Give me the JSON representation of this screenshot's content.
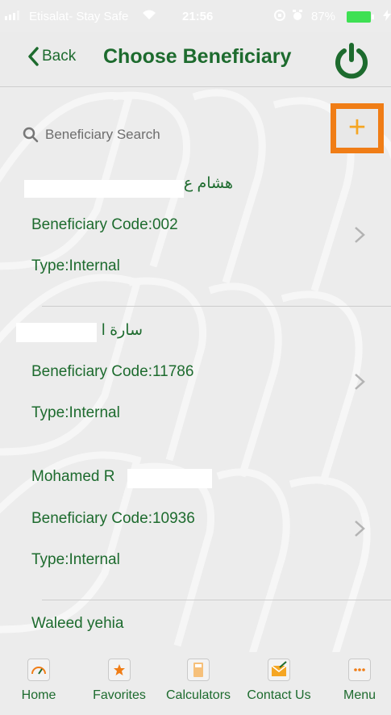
{
  "status_bar": {
    "carrier": "Etisalat- Stay Safe",
    "time": "21:56",
    "battery": "87%"
  },
  "nav": {
    "back_label": "Back",
    "title": "Choose Beneficiary"
  },
  "search": {
    "placeholder": "Beneficiary Search"
  },
  "add_button": {
    "label": "+"
  },
  "beneficiaries": [
    {
      "name": "هشام ع",
      "code": "Beneficiary Code:002",
      "type": "Type:Internal"
    },
    {
      "name": "سارة ا",
      "code": "Beneficiary Code:11786",
      "type": "Type:Internal"
    },
    {
      "name": "Mohamed R",
      "code": "Beneficiary Code:10936",
      "type": "Type:Internal"
    },
    {
      "name": "Waleed yehia"
    }
  ],
  "tabbar": [
    {
      "label": "Home",
      "icon": "speedometer-icon"
    },
    {
      "label": "Favorites",
      "icon": "star-icon"
    },
    {
      "label": "Calculators",
      "icon": "calculator-icon"
    },
    {
      "label": "Contact Us",
      "icon": "envelope-icon"
    },
    {
      "label": "Menu",
      "icon": "more-icon"
    }
  ],
  "colors": {
    "brand_green": "#1d6b2e",
    "accent_orange": "#f07d16",
    "plus_yellow": "#f5a623"
  }
}
